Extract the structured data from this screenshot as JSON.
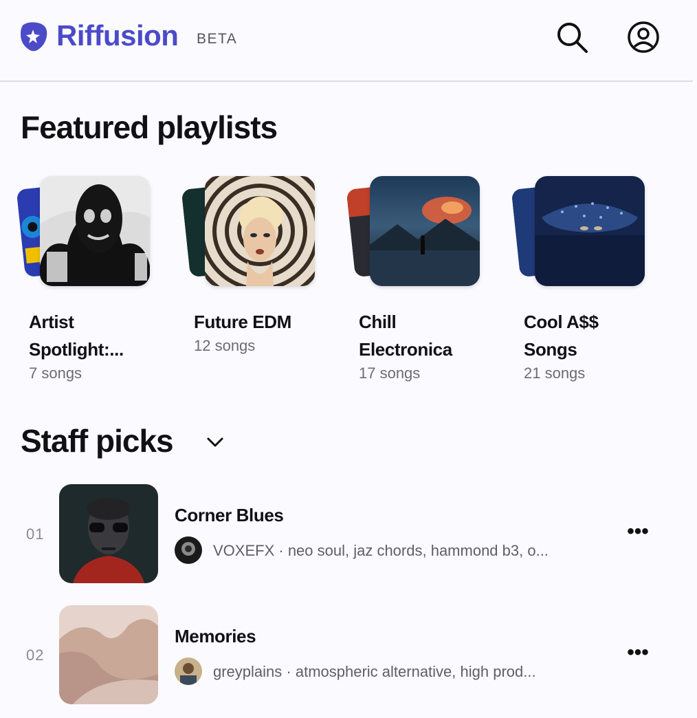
{
  "header": {
    "brand": "Riffusion",
    "beta": "BETA",
    "icons": {
      "logo": "riffusion-logo-icon",
      "search": "search-icon",
      "account": "account-icon"
    }
  },
  "featured": {
    "title": "Featured playlists",
    "playlists": [
      {
        "name": "Artist Spotlight:...",
        "count": "7 songs"
      },
      {
        "name": "Future EDM",
        "count": "12 songs"
      },
      {
        "name": "Chill Electronica",
        "count": "17 songs"
      },
      {
        "name": "Cool A$$ Songs",
        "count": "21 songs"
      }
    ]
  },
  "staff": {
    "title": "Staff picks",
    "tracks": [
      {
        "num": "01",
        "title": "Corner Blues",
        "artist": "VOXEFX",
        "sep": " · ",
        "tags": "neo soul, jaz chords, hammond b3, o..."
      },
      {
        "num": "02",
        "title": "Memories",
        "artist": "greyplains",
        "sep": " · ",
        "tags": "atmospheric alternative, high prod..."
      }
    ]
  },
  "colors": {
    "brand": "#4b4bc8",
    "background": "#fbfaff",
    "muted": "#6b6b75"
  }
}
